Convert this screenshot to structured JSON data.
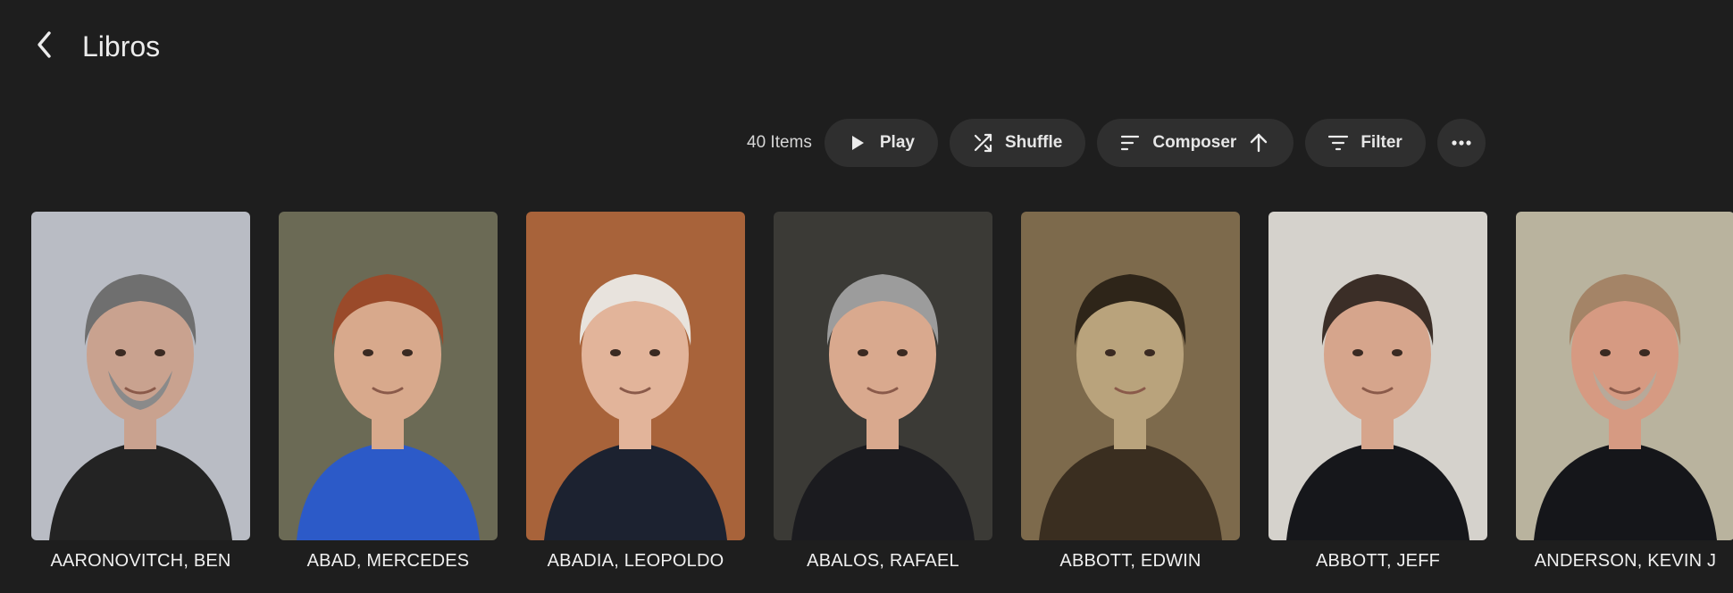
{
  "header": {
    "title": "Libros"
  },
  "toolbar": {
    "count": "40 Items",
    "play_label": "Play",
    "shuffle_label": "Shuffle",
    "sort_label": "Composer",
    "filter_label": "Filter"
  },
  "artists": [
    {
      "name": "AARONOVITCH, BEN",
      "bg": "#b9bcc4",
      "skin": "#c9a28f",
      "hair": "#6f6f6f",
      "shirt": "#232323",
      "beard": "#8a8a8a"
    },
    {
      "name": "ABAD, MERCEDES",
      "bg": "#6b6a55",
      "skin": "#d8a98c",
      "hair": "#9a4a2a",
      "shirt": "#2c5ac8",
      "beard": null
    },
    {
      "name": "ABADIA, LEOPOLDO",
      "bg": "#a8633a",
      "skin": "#e2b49a",
      "hair": "#e8e3dd",
      "shirt": "#1c2230",
      "beard": null
    },
    {
      "name": "ABALOS, RAFAEL",
      "bg": "#3b3a36",
      "skin": "#d9a98e",
      "hair": "#9c9c9c",
      "shirt": "#1b1b1f",
      "beard": null
    },
    {
      "name": "ABBOTT, EDWIN",
      "bg": "#7d6a4c",
      "skin": "#b9a37c",
      "hair": "#2e2519",
      "shirt": "#3a2e20",
      "beard": null
    },
    {
      "name": "ABBOTT, JEFF",
      "bg": "#d5d2cc",
      "skin": "#d6a58c",
      "hair": "#3b2e27",
      "shirt": "#16171b",
      "beard": null
    },
    {
      "name": "ANDERSON, KEVIN J",
      "bg": "#b9b39e",
      "skin": "#d69a82",
      "hair": "#a48467",
      "shirt": "#15161a",
      "beard": "#b7a99a"
    }
  ]
}
